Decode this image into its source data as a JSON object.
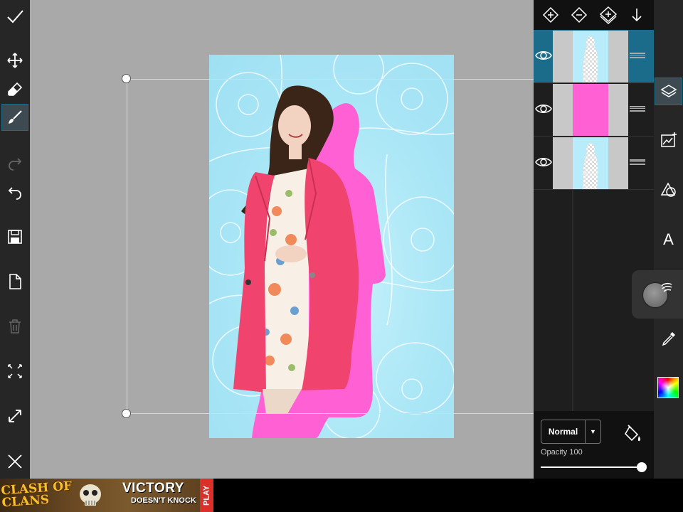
{
  "left_toolbar": {
    "tools": [
      {
        "name": "confirm-icon",
        "active": false
      },
      {
        "name": "move-icon",
        "active": false
      },
      {
        "name": "eraser-icon",
        "active": false
      },
      {
        "name": "brush-icon",
        "active": true
      },
      {
        "name": "redo-icon",
        "active": false
      },
      {
        "name": "undo-icon",
        "active": false
      },
      {
        "name": "save-icon",
        "active": false
      },
      {
        "name": "new-file-icon",
        "active": false
      },
      {
        "name": "trash-icon",
        "active": false
      },
      {
        "name": "fit-screen-icon",
        "active": false
      },
      {
        "name": "resize-icon",
        "active": false
      },
      {
        "name": "close-icon",
        "active": false
      }
    ]
  },
  "layers_toolbar": {
    "buttons": [
      "add-layer-icon",
      "remove-layer-icon",
      "merge-layer-icon",
      "move-down-icon"
    ]
  },
  "layers": [
    {
      "name": "layer-1",
      "visible": true,
      "selected": true,
      "thumb": "figure-checker"
    },
    {
      "name": "layer-2",
      "visible": true,
      "selected": false,
      "thumb": "solid-pink"
    },
    {
      "name": "layer-3",
      "visible": true,
      "selected": false,
      "thumb": "figure-checker"
    }
  ],
  "blend": {
    "mode": "Normal",
    "opacity_label": "Opacity 100",
    "opacity": 100
  },
  "right_toolbar": {
    "tools": [
      {
        "name": "layers-icon",
        "active": true
      },
      {
        "name": "image-adjust-icon",
        "active": false
      },
      {
        "name": "shapes-icon",
        "active": false
      },
      {
        "name": "text-tool-icon",
        "label": "A",
        "active": false
      },
      {
        "name": "brush-settings-icon",
        "active": false
      },
      {
        "name": "eyedropper-icon",
        "active": false
      },
      {
        "name": "color-picker-icon",
        "active": false
      }
    ]
  },
  "ad": {
    "brand": "CLASH OF CLANS",
    "headline": "VICTORY",
    "subline": "DOESN'T KNOCK",
    "cta": "PLAY"
  },
  "colors": {
    "accent": "#1b6c8b",
    "pink": "#ff5ed2",
    "coat": "#f0446e",
    "background_blue": "#aee7f7"
  }
}
